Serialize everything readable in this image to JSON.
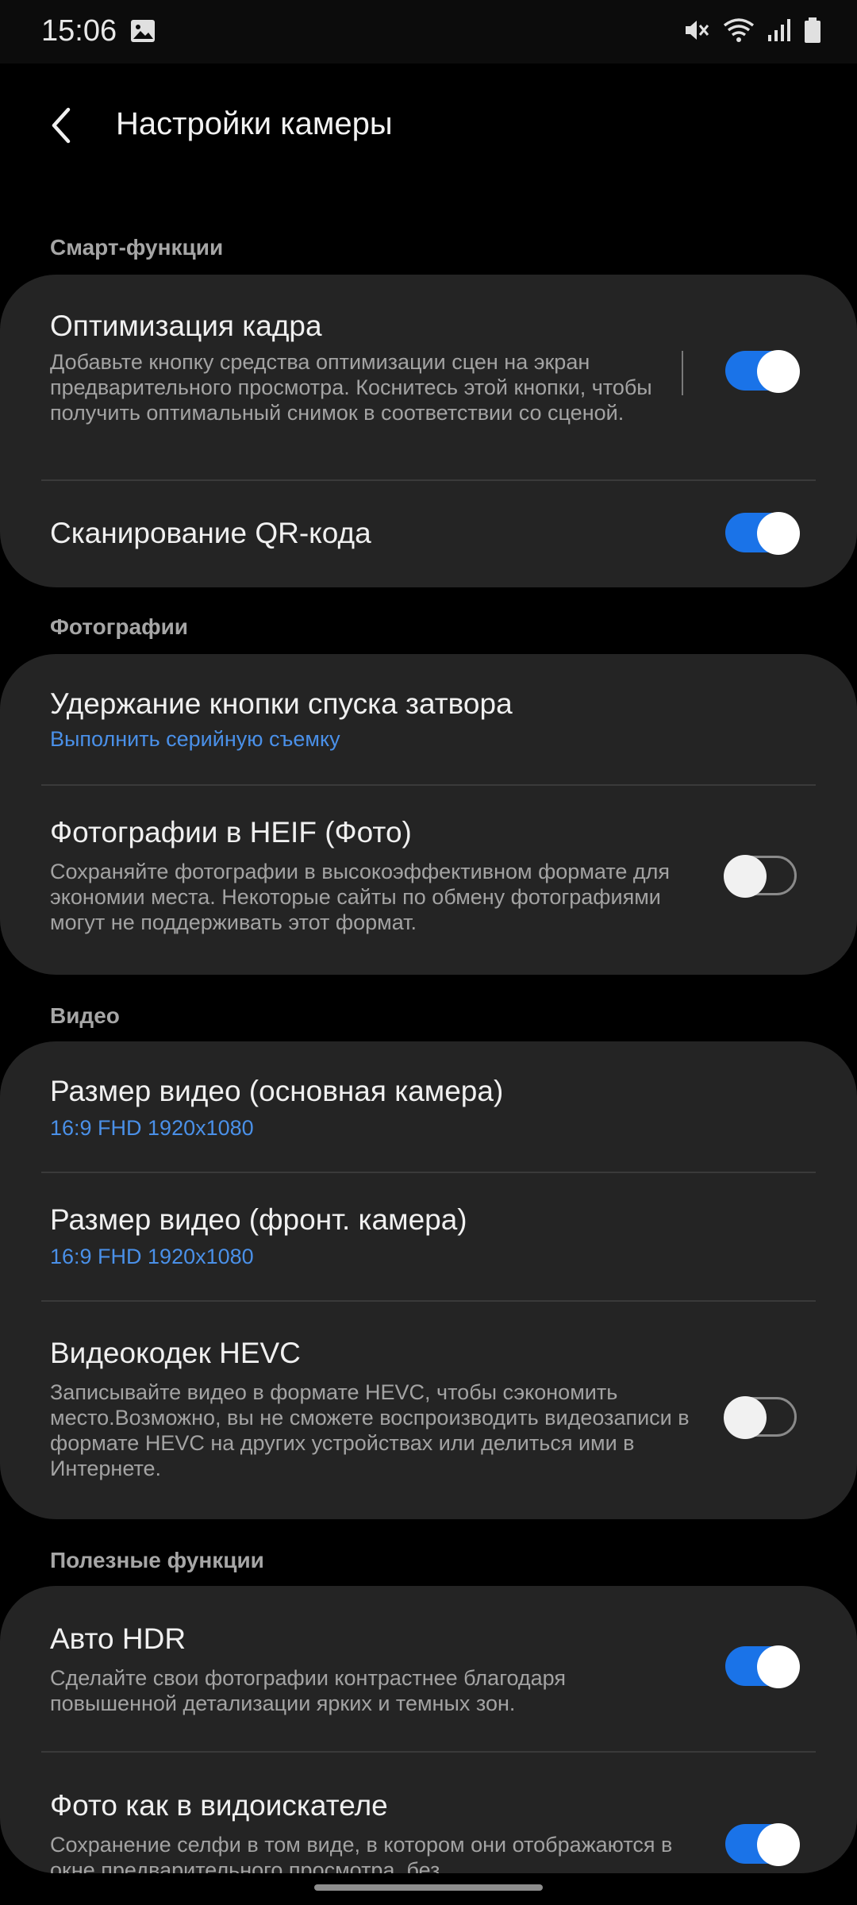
{
  "status_bar": {
    "time": "15:06"
  },
  "header": {
    "title": "Настройки камеры"
  },
  "sections": [
    {
      "label": "Смарт-функции",
      "items": [
        {
          "title": "Оптимизация кадра",
          "desc": "Добавьте кнопку средства оптимизации сцен на экран предварительного просмотра. Коснитесь этой кнопки, чтобы получить оптимальный снимок в соответствии со сценой.",
          "toggle": "on"
        },
        {
          "title": "Сканирование QR-кода",
          "toggle": "on"
        }
      ]
    },
    {
      "label": "Фотографии",
      "items": [
        {
          "title": "Удержание кнопки спуска затвора",
          "value": "Выполнить серийную съемку"
        },
        {
          "title": "Фотографии в HEIF (Фото)",
          "desc": "Сохраняйте фотографии в высокоэффективном формате для экономии места. Некоторые сайты по обмену фотографиями могут не поддерживать этот формат.",
          "toggle": "off"
        }
      ]
    },
    {
      "label": "Видео",
      "items": [
        {
          "title": "Размер видео (основная камера)",
          "value": "16:9 FHD 1920x1080"
        },
        {
          "title": "Размер видео (фронт. камера)",
          "value": "16:9 FHD 1920x1080"
        },
        {
          "title": "Видеокодек HEVC",
          "desc": "Записывайте видео в формате HEVC, чтобы сэкономить место.Возможно, вы не сможете воспроизводить видеозаписи в формате HEVC на других устройствах или делиться ими в Интернете.",
          "toggle": "off"
        }
      ]
    },
    {
      "label": "Полезные функции",
      "items": [
        {
          "title": "Авто HDR",
          "desc": "Сделайте свои фотографии контрастнее благодаря повышенной детализации ярких и темных зон.",
          "toggle": "on"
        },
        {
          "title": "Фото как в видоискателе",
          "desc": "Сохранение селфи в том виде, в котором они отображаются в окне предварительного просмотра, без",
          "toggle": "on"
        }
      ]
    }
  ],
  "colors": {
    "accent": "#1a73e8",
    "value_text": "#4a90e8",
    "card": "#242424",
    "background": "#000000"
  }
}
